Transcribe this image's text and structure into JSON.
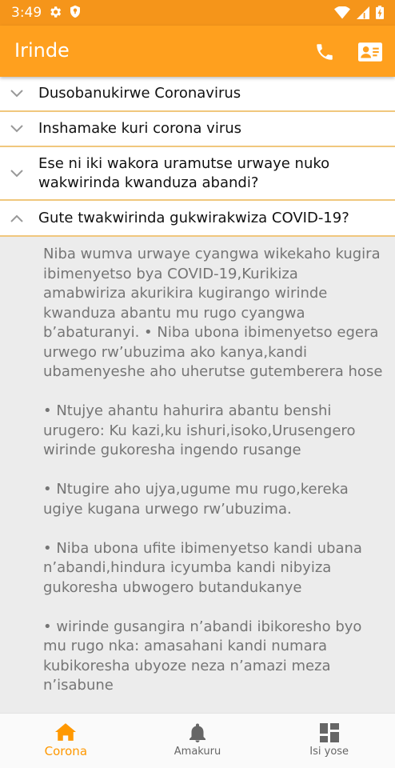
{
  "status_bar": {
    "time": "3:49",
    "icons": [
      "gear-icon",
      "shield-icon",
      "wifi-icon",
      "signal-icon",
      "battery-charging-icon"
    ]
  },
  "app_bar": {
    "title": "Irinde",
    "actions": [
      "phone-icon",
      "contacts-icon"
    ]
  },
  "faq": [
    {
      "title": "Dusobanukirwe Coronavirus",
      "expanded": false
    },
    {
      "title": "Inshamake kuri corona virus",
      "expanded": false
    },
    {
      "title": "Ese ni iki wakora uramutse urwaye nuko wakwirinda kwanduza abandi?",
      "expanded": false
    },
    {
      "title": "Gute twakwirinda gukwirakwiza COVID-19?",
      "expanded": true,
      "answer": "Niba wumva urwaye cyangwa wikekaho kugira ibimenyetso bya COVID-19,Kurikiza amabwiriza akurikira kugirango wirinde kwanduza abantu mu rugo cyangwa b’abaturanyi. • Niba ubona ibimenyetso egera urwego rw’ubuzima ako kanya,kandi ubamenyeshe aho uherutse gutemberera hose\n\n • Ntujye ahantu hahurira abantu benshi urugero: Ku kazi,ku ishuri,isoko,Urusengero wirinde gukoresha ingendo rusange\n\n • Ntugire aho ujya,ugume mu rugo,kereka ugiye kugana urwego rw’ubuzima.\n\n • Niba ubona ufite ibimenyetso kandi ubana n’abandi,hindura icyumba kandi nibyiza gukoresha ubwogero butandukanye\n\n • wirinde gusangira n’abandi ibikoresho byo mu rugo nka: amasahani kandi numara kubikoresha ubyoze neza n’amazi meza n’isabune"
    }
  ],
  "bottom_nav": {
    "items": [
      {
        "label": "Corona",
        "icon": "home-icon",
        "active": true
      },
      {
        "label": "Amakuru",
        "icon": "bell-icon",
        "active": false
      },
      {
        "label": "Isi yose",
        "icon": "dashboard-icon",
        "active": false
      }
    ]
  },
  "colors": {
    "status_bar": "#f5951a",
    "app_bar": "#ffa01e",
    "accent": "#ff9800",
    "divider": "#f0c77d",
    "answer_text": "#757575",
    "answer_bg": "#ececec"
  }
}
